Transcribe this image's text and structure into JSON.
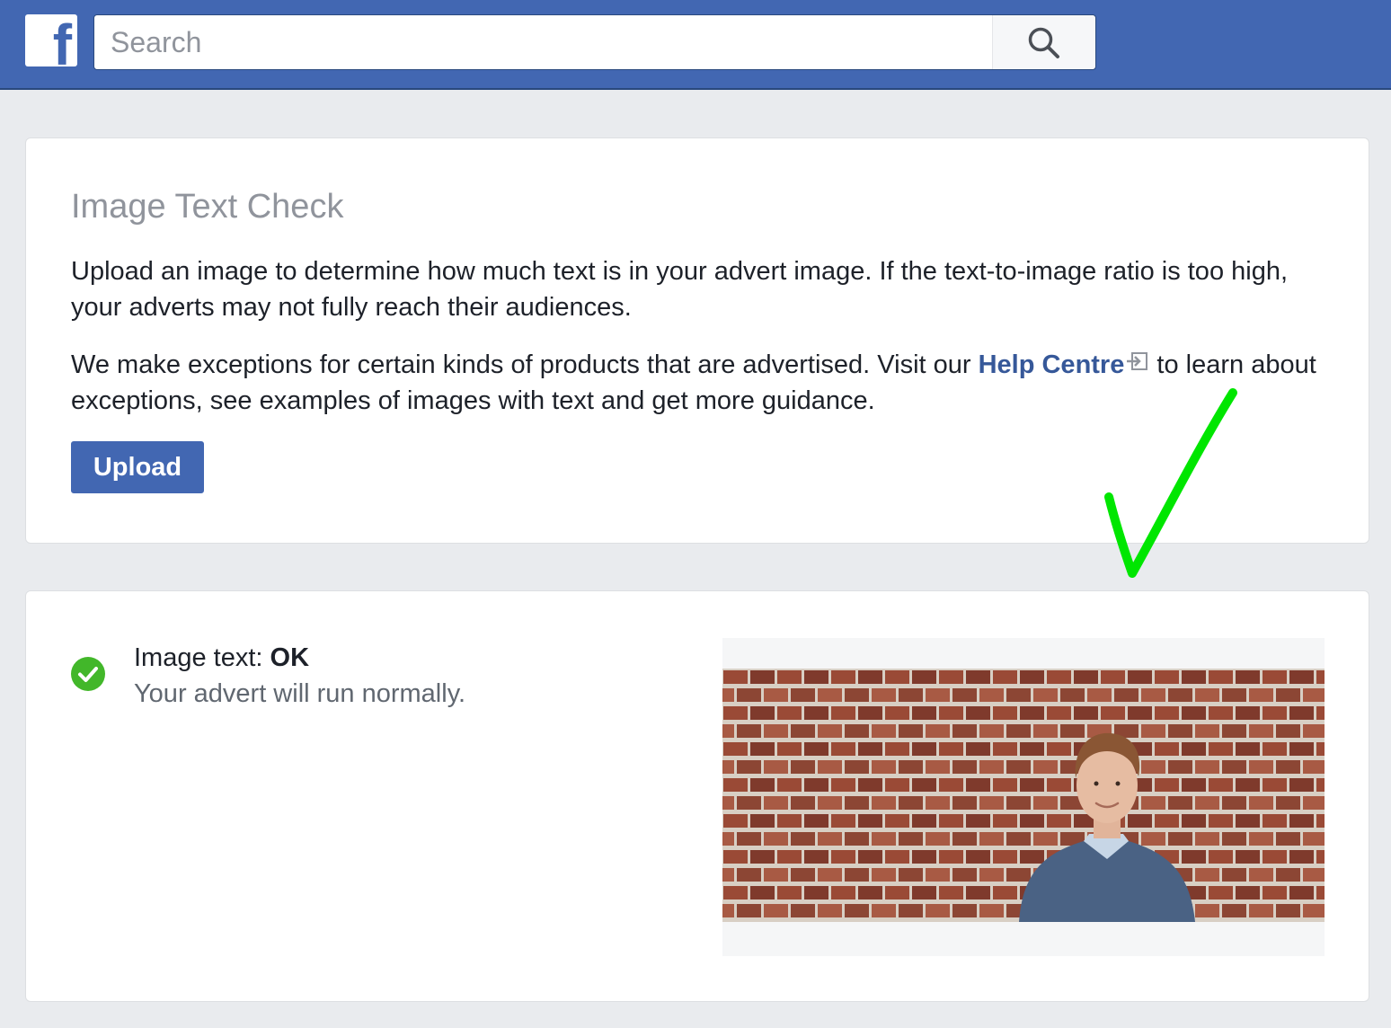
{
  "header": {
    "logo": "f",
    "search_placeholder": "Search",
    "search_icon": "search-icon"
  },
  "card1": {
    "title": "Image Text Check",
    "paragraph1": "Upload an image to determine how much text is in your advert image. If the text-to-image ratio is too high, your adverts may not fully reach their audiences.",
    "paragraph2_before": "We make exceptions for certain kinds of products that are advertised. Visit our ",
    "help_link": "Help Centre",
    "paragraph2_after": " to learn about exceptions, see examples of images with text and get more guidance.",
    "upload_label": "Upload"
  },
  "card2": {
    "status_prefix": "Image text: ",
    "status_value": "OK",
    "status_detail": "Your advert will run normally.",
    "status_icon": "check-circle-icon"
  },
  "colors": {
    "brand": "#4267b2",
    "link": "#365899",
    "success": "#42b72a",
    "annotation": "#00e600"
  }
}
